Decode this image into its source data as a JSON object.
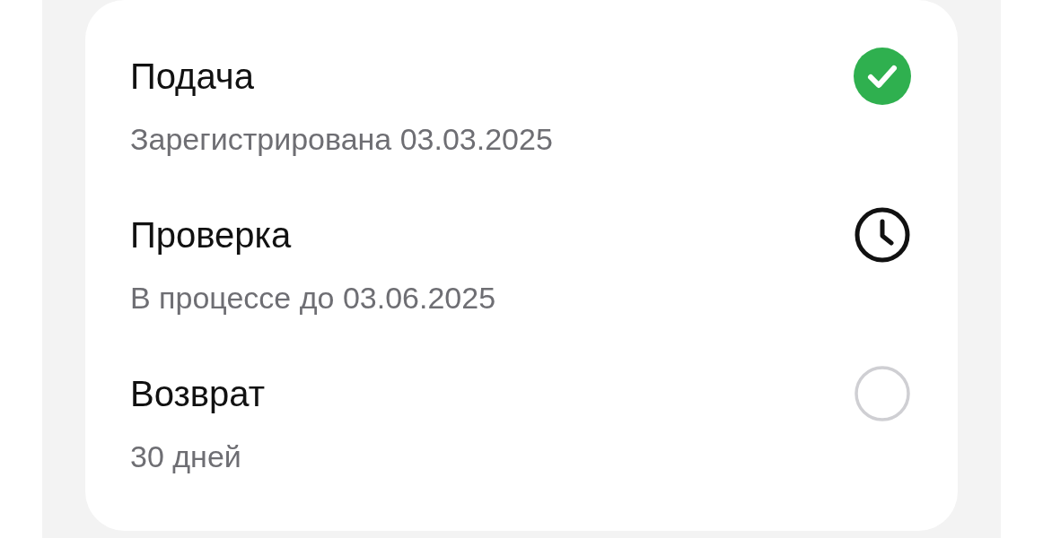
{
  "steps": [
    {
      "title": "Подача",
      "subtitle": "Зарегистрирована 03.03.2025",
      "kind": "done"
    },
    {
      "title": "Проверка",
      "subtitle": "В процессе до 03.06.2025",
      "kind": "waiting"
    },
    {
      "title": "Возврат",
      "subtitle": "30 дней",
      "kind": "pending"
    }
  ]
}
